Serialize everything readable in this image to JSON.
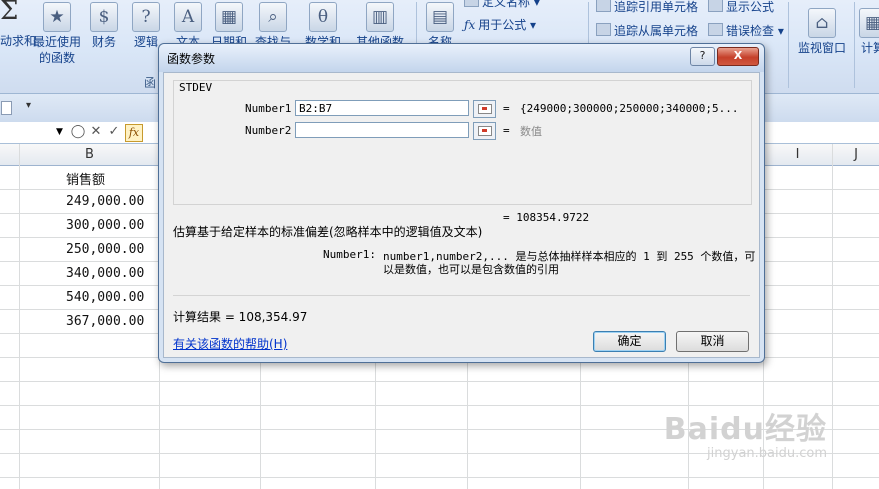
{
  "ribbon": {
    "autosum_tail": "动求和",
    "buttons": [
      {
        "icon": "recent-functions-icon",
        "glyph": "★",
        "label": "最近使用",
        "sub": "的函数"
      },
      {
        "icon": "finance-icon",
        "glyph": "$",
        "label": "财务",
        "sub": ""
      },
      {
        "icon": "logical-icon",
        "glyph": "?",
        "label": "逻辑",
        "sub": ""
      },
      {
        "icon": "text-icon",
        "glyph": "A",
        "label": "文本",
        "sub": ""
      },
      {
        "icon": "datetime-icon",
        "glyph": "▦",
        "label": "日期和",
        "sub": ""
      },
      {
        "icon": "lookup-icon",
        "glyph": "⌕",
        "label": "查找与",
        "sub": ""
      },
      {
        "icon": "math-icon",
        "glyph": "θ",
        "label": "数学和",
        "sub": ""
      },
      {
        "icon": "more-functions-icon",
        "glyph": "▥",
        "label": "其他函数",
        "sub": ""
      }
    ],
    "group_function_library_fragment": "函",
    "name_manager": "名称",
    "define_name": "定义名称",
    "use_in_formula": "用于公式",
    "trace_precedents": "追踪引用单元格",
    "trace_dependents": "追踪从属单元格",
    "show_formulas": "显示公式",
    "error_checking": "错误检查",
    "watch_window": "监视窗口",
    "calculate_fragment": "计算"
  },
  "sheet": {
    "columns": [
      "B",
      "I",
      "J"
    ],
    "header_cell": "销售额",
    "values": [
      "249,000.00",
      "300,000.00",
      "250,000.00",
      "340,000.00",
      "540,000.00",
      "367,000.00"
    ]
  },
  "dialog": {
    "title": "函数参数",
    "function_name": "STDEV",
    "args": [
      {
        "label": "Number1",
        "value": "B2:B7",
        "result": "{249000;300000;250000;340000;5..."
      },
      {
        "label": "Number2",
        "value": "",
        "result": "数值"
      }
    ],
    "equals": "=",
    "formula_result_inline": "= 108354.9722",
    "description": "估算基于给定样本的标准偏差(忽略样本中的逻辑值及文本)",
    "arg_help_label": "Number1:",
    "arg_help_line1": "number1,number2,... 是与总体抽样样本相应的 1 到 255 个数值，可",
    "arg_help_line2": "以是数值，也可以是包含数值的引用",
    "calc_result": "计算结果 =  108,354.97",
    "help_link": "有关该函数的帮助(H)",
    "ok": "确定",
    "cancel": "取消",
    "help_btn": "?",
    "close_btn": "X"
  },
  "watermark": {
    "brand": "Baidu经验",
    "url": "jingyan.baidu.com"
  }
}
